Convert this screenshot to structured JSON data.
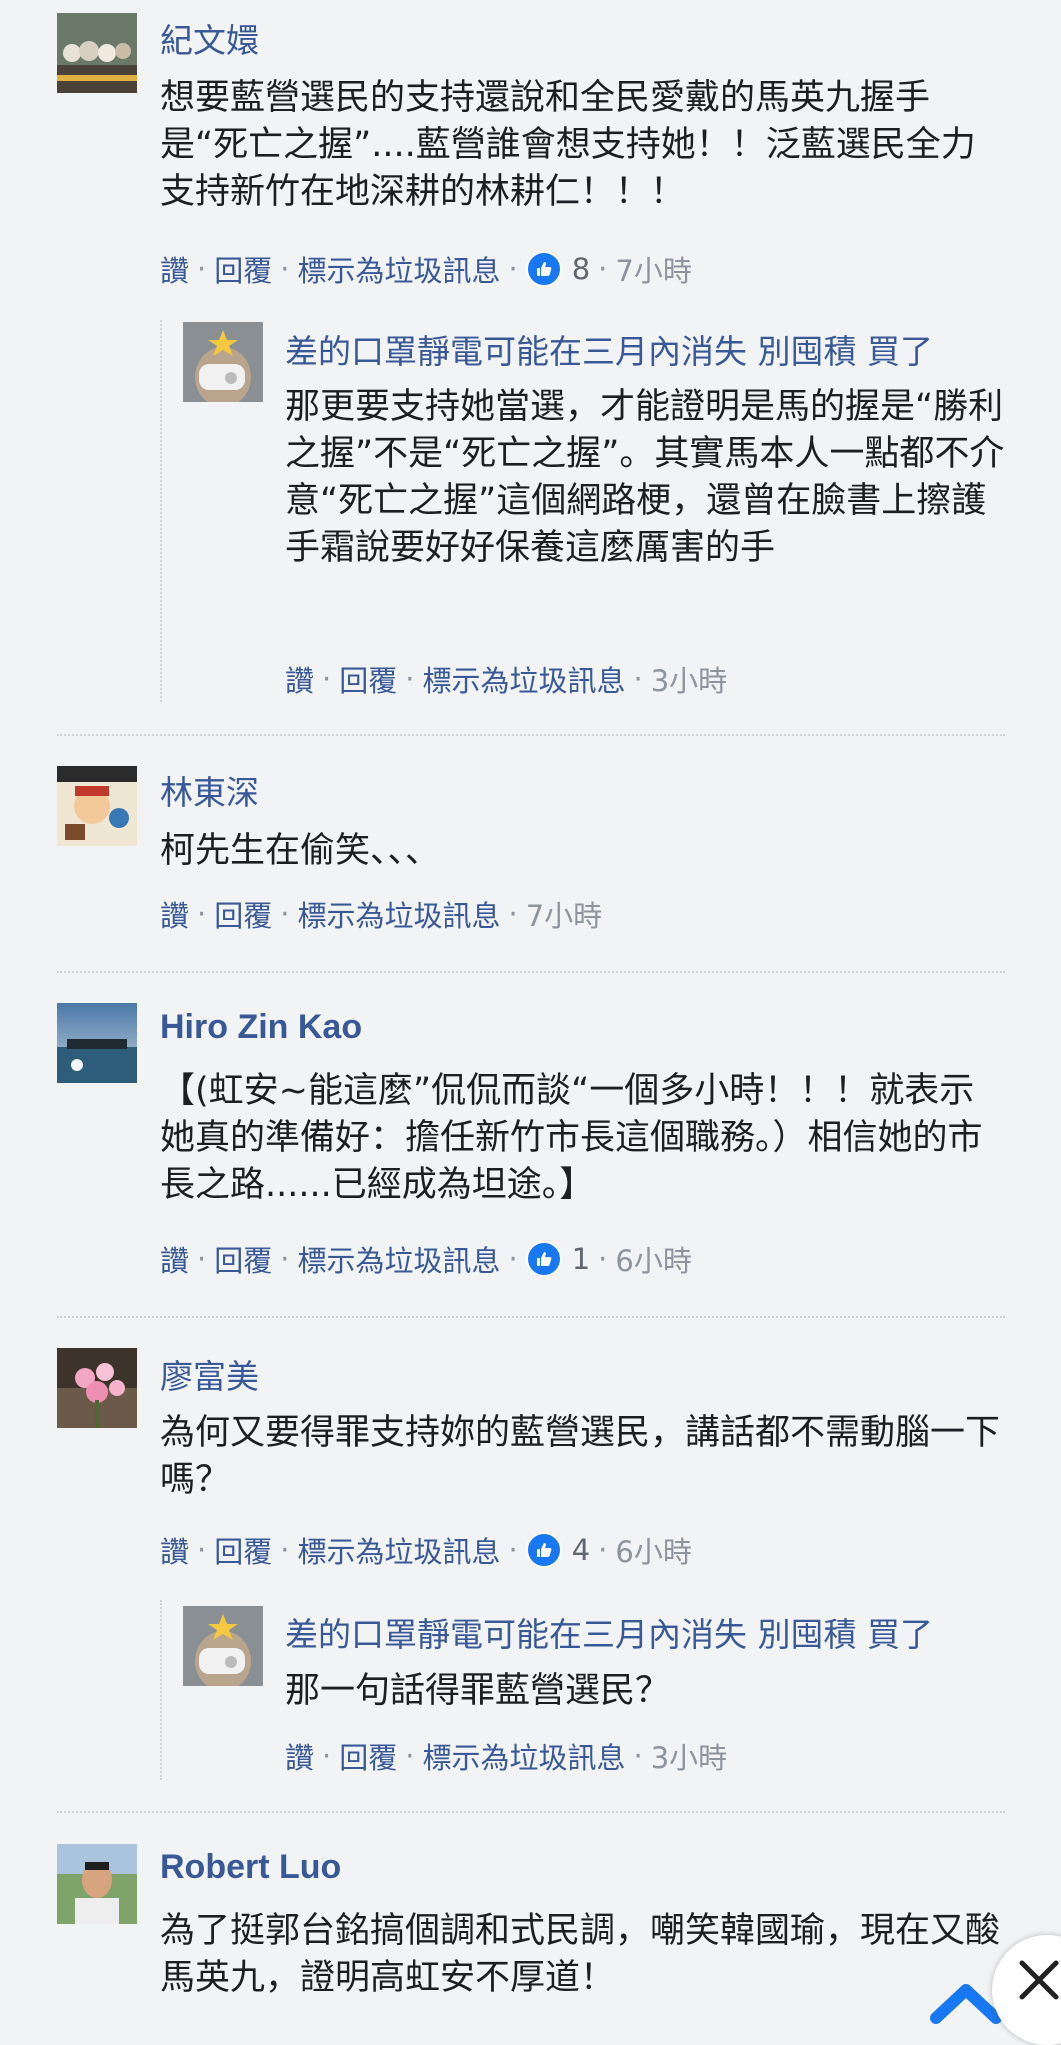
{
  "actions": {
    "like": "讚",
    "reply": "回覆",
    "spam": "標示為垃圾訊息",
    "sep": "·"
  },
  "comments": [
    {
      "author": "紀文嬛",
      "text": "想要藍營選民的支持還說和全民愛戴的馬英九握手是“死亡之握”....藍營誰會想支持她！！泛藍選民全力支持新竹在地深耕的林耕仁！！！",
      "likes": "8",
      "time": "7小時",
      "reply": {
        "author": "差的口罩靜電可能在三月內消失 別囤積 買了",
        "text": "那更要支持她當選，才能證明是馬的握是“勝利之握”不是“死亡之握”。其實馬本人一點都不介意“死亡之握”這個網路梗，還曾在臉書上擦護手霜說要好好保養這麼厲害的手",
        "time": "3小時"
      }
    },
    {
      "author": "林東深",
      "text": "柯先生在偷笑、、、",
      "time": "7小時"
    },
    {
      "author": "Hiro Zin Kao",
      "text": "【(虹安~能這麼”侃侃而談“一個多小時！！！就表示她真的準備好：擔任新竹市長這個職務。）相信她的市長之路......已經成為坦途。】",
      "likes": "1",
      "time": "6小時"
    },
    {
      "author": "廖富美",
      "text": "為何又要得罪支持妳的藍營選民，講話都不需動腦一下嗎？",
      "likes": "4",
      "time": "6小時",
      "reply": {
        "author": "差的口罩靜電可能在三月內消失 別囤積 買了",
        "text": "那一句話得罪藍營選民？",
        "time": "3小時"
      }
    },
    {
      "author": "Robert Luo",
      "text": "為了挺郭台銘搞個調和式民調，嘲笑韓國瑜，現在又酸馬英九，證明高虹安不厚道！"
    }
  ],
  "colors": {
    "link": "#385898",
    "meta": "#606770",
    "like_blue": "#1877f2",
    "background": "#f2f3f5"
  }
}
